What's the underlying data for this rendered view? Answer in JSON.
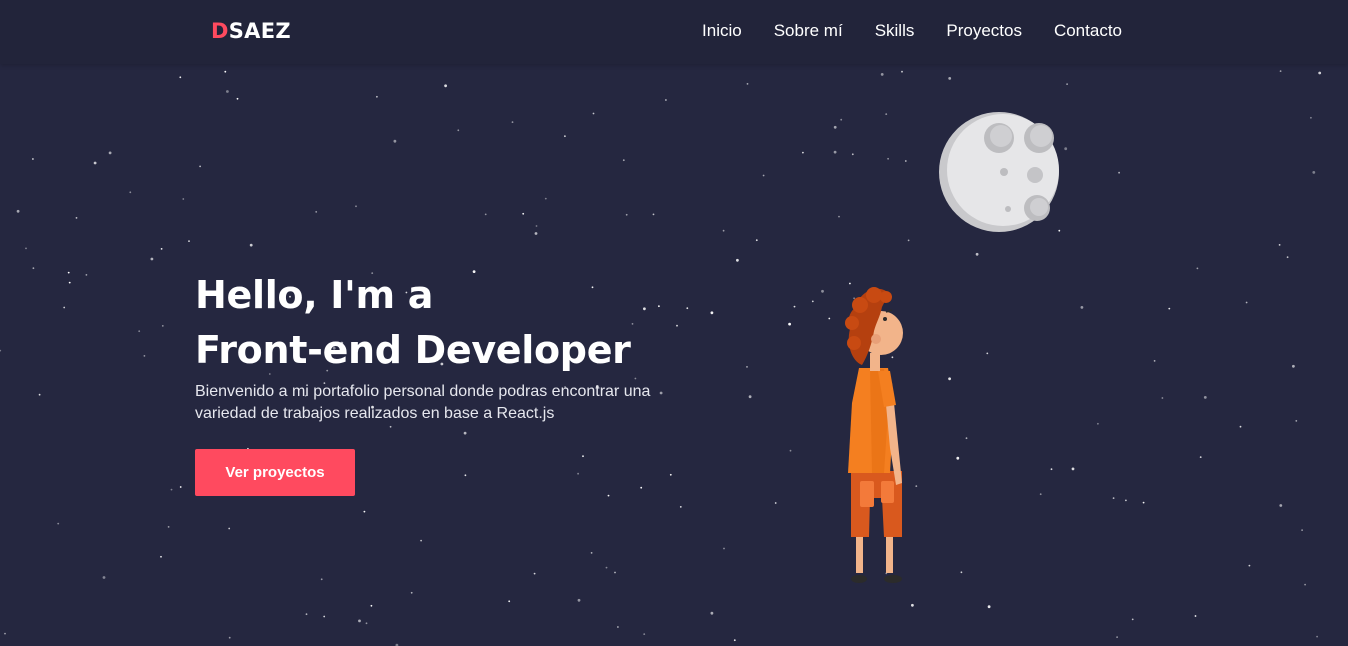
{
  "navbar": {
    "logo_accent": "D",
    "logo_rest": "SAEZ",
    "links": [
      "Inicio",
      "Sobre mí",
      "Skills",
      "Proyectos",
      "Contacto"
    ]
  },
  "hero": {
    "title_line1": "Hello, I'm a",
    "title_line2": "Front-end Developer",
    "subtitle_line1": "Bienvenido a mi portafolio personal donde podras encontrar una",
    "subtitle_line2": "variedad de trabajos realizados en base a React.js",
    "cta_label": "Ver proyectos"
  },
  "colors": {
    "background": "#252740",
    "navbar": "#22243a",
    "accent": "#ff4a5f",
    "text": "#ffffff"
  },
  "illustrations": [
    "moon",
    "boy-looking-up",
    "starfield"
  ]
}
